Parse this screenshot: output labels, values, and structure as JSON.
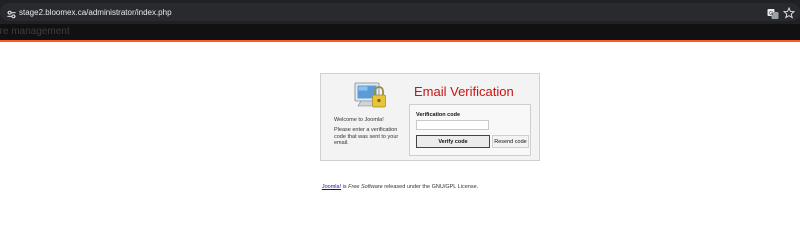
{
  "browser": {
    "url": "stage2.bloomex.ca/administrator/index.php",
    "site_info_icon": "tune-icon",
    "translate_icon": "translate-icon",
    "bookmark_icon": "star-icon"
  },
  "header": {
    "title": "ore management",
    "accent_color": "#ff5a24"
  },
  "panel": {
    "title": "Email Verification",
    "title_color": "#cc1111",
    "welcome": "Welcome to Joomla!",
    "instructions": "Please enter a verification code that was sent to your email.",
    "illustration_icon": "computer-lock-icon",
    "form": {
      "label": "Verification code",
      "input_value": "",
      "verify_label": "Verify code",
      "resend_label": "Resend code"
    }
  },
  "footer": {
    "link_text": "Joomla!",
    "middle_text": " is ",
    "free_software": "Free Software",
    "tail_text": " released under the GNU/GPL License."
  }
}
